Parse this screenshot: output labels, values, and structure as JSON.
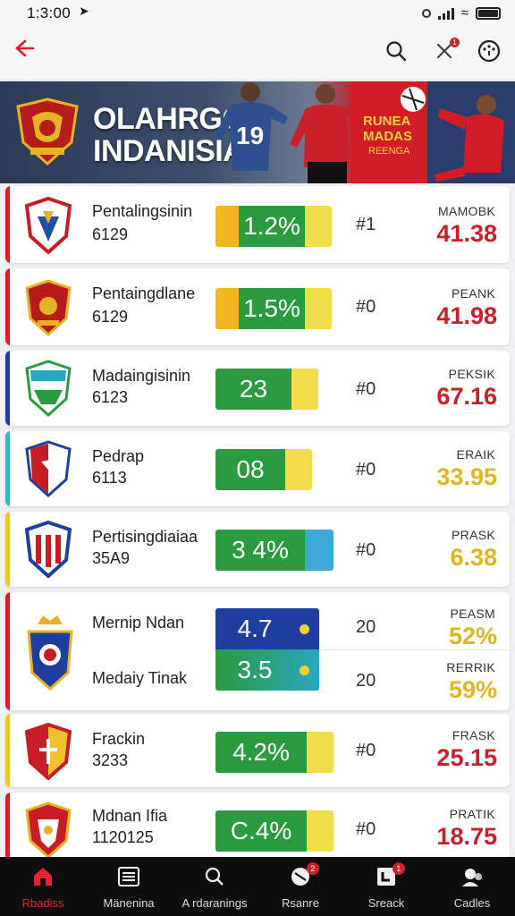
{
  "status_bar": {
    "time": "1:3:00",
    "location_icon": "location-arrow-icon"
  },
  "top_bar": {
    "back_icon": "back-arrow-icon",
    "search_icon": "search-icon",
    "close_icon": "close-icon",
    "close_badge": "1",
    "settings_icon": "dial-icon"
  },
  "banner": {
    "title_line1": "OLAHRGGA",
    "title_line2": "INDANISIA",
    "jersey_number": "19",
    "ad_line1": "RUNEA",
    "ad_line2": "MADAS",
    "ad_line3": "REENGA"
  },
  "colors": {
    "accent_red": "#d3202a",
    "green": "#2a9b3f",
    "yellow": "#f2c12e",
    "blue": "#1f4fa0",
    "teal": "#2aa6a0"
  },
  "rows": [
    {
      "name": "Pentalingsinin",
      "code": "6129",
      "bar_value": "1.2%",
      "rank": "#1",
      "label": "MAMOBK",
      "score": "41.38",
      "score_color": "#cc1f2a",
      "stripe": "#d3202a"
    },
    {
      "name": "Pentaingdlane",
      "code": "6129",
      "bar_value": "1.5%",
      "rank": "#0",
      "label": "PEANK",
      "score": "41.98",
      "score_color": "#cc1f2a",
      "stripe": "#d3202a"
    },
    {
      "name": "Madaingisinin",
      "code": "6123",
      "bar_value": "23",
      "rank": "#0",
      "label": "PEKSIK",
      "score": "67.16",
      "score_color": "#cc1f2a",
      "stripe": "#1f3fa0"
    },
    {
      "name": "Pedrap",
      "code": "6113",
      "bar_value": "08",
      "rank": "#0",
      "label": "ERAIK",
      "score": "33.95",
      "score_color": "#e2b621",
      "stripe": "#3ab6c2"
    },
    {
      "name": "Pertisingdiaiaa",
      "code": "35A9",
      "bar_value": "3 4%",
      "rank": "#0",
      "label": "PRASK",
      "score": "6.38",
      "score_color": "#e2b621",
      "stripe": "#f2c12e"
    },
    {
      "name": "Mernip Ndan",
      "bar_value": "4.7",
      "rank": "20",
      "label": "PEASM",
      "score": "52%",
      "score_color": "#e2b621",
      "stripe": "#d3202a",
      "name2": "Medaiy Tinak",
      "bar_value2": "3.5",
      "rank2": "20",
      "label2": "RERRIK",
      "score2": "59%",
      "score_color2": "#e2b621"
    },
    {
      "name": "Frackin",
      "code": "3233",
      "bar_value": "4.2%",
      "rank": "#0",
      "label": "FRASK",
      "score": "25.15",
      "score_color": "#cc1f2a",
      "stripe": "#f2c12e"
    },
    {
      "name": "Mdnan Ifia",
      "code": "1120125",
      "bar_value": "C.4%",
      "rank": "#0",
      "label": "PRATIK",
      "score": "18.75",
      "score_color": "#cc1f2a",
      "stripe": "#d3202a"
    }
  ],
  "nav": [
    {
      "label": "Rbadiss",
      "icon": "home-icon",
      "active": true
    },
    {
      "label": "Mänenina",
      "icon": "list-icon"
    },
    {
      "label": "A rdaranings",
      "icon": "search-icon"
    },
    {
      "label": "Rsanre",
      "icon": "ball-icon",
      "badge": "2"
    },
    {
      "label": "Sreack",
      "icon": "scoreboard-icon",
      "badge": "1"
    },
    {
      "label": "Cadles",
      "icon": "profile-icon"
    }
  ]
}
